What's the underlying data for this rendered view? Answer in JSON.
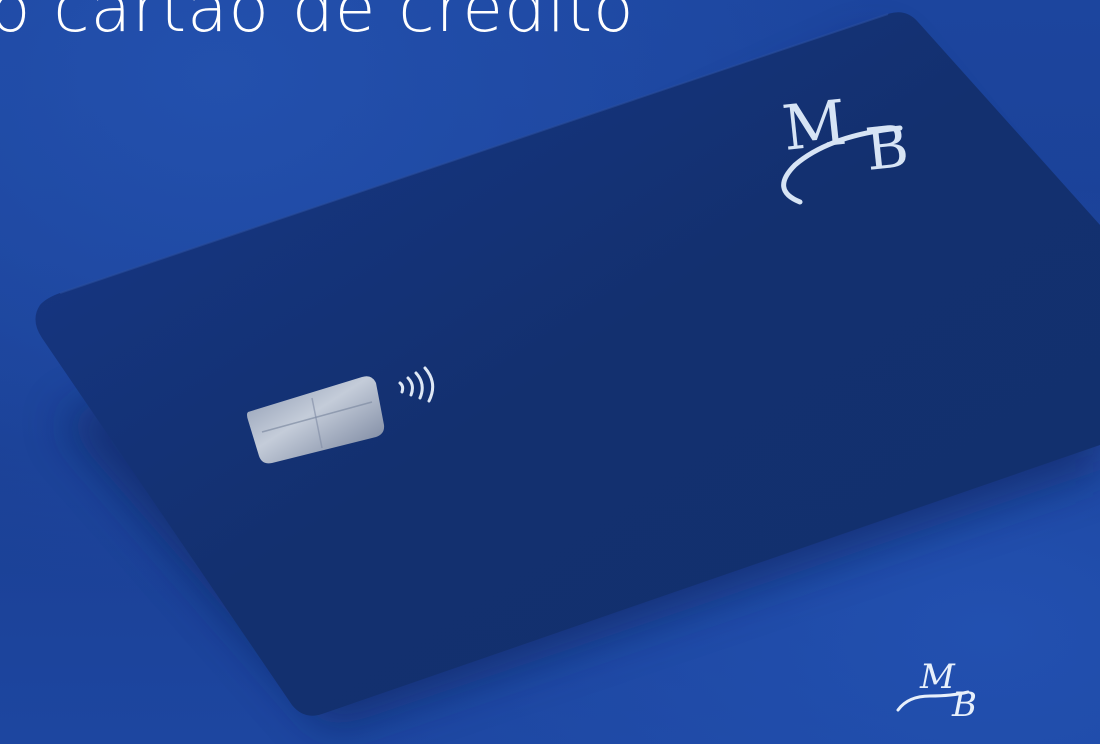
{
  "headline": "o cartão de crédito",
  "card": {
    "logo_text": "MB",
    "color": "#132f73",
    "chip": "chip-icon",
    "contactless": "contactless-icon"
  },
  "corner_logo": {
    "text": "MB",
    "icon": "mb-logo-icon"
  },
  "colors": {
    "background": "#1a3f93",
    "card": "#132f73",
    "logo": "#cfe0f4"
  }
}
